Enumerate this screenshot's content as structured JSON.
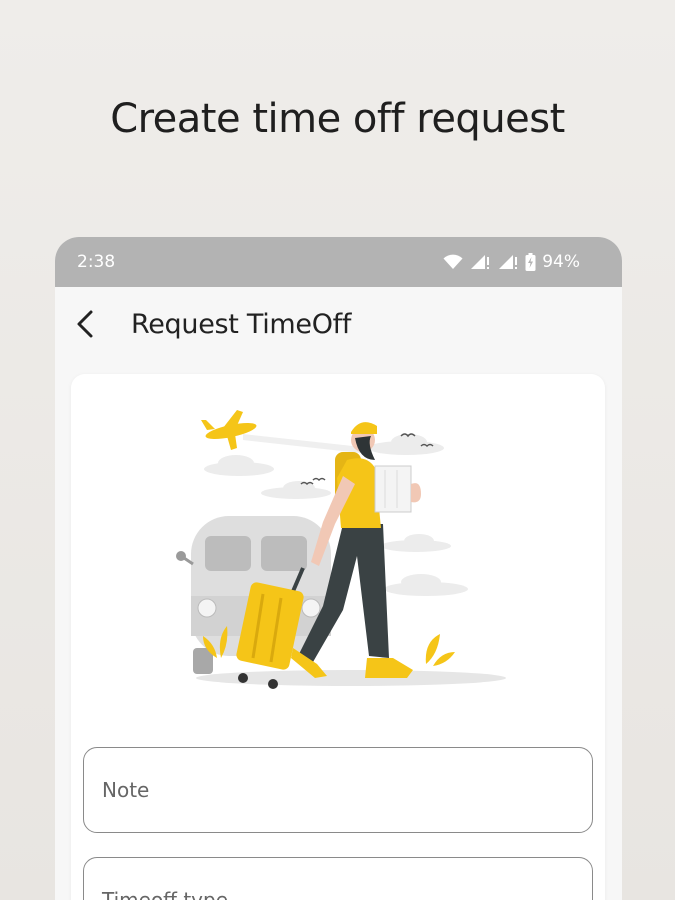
{
  "headline": "Create time off request",
  "status_bar": {
    "time": "2:38",
    "battery": "94%",
    "icons": [
      "wifi-icon",
      "signal-icon",
      "signal-icon",
      "battery-icon"
    ]
  },
  "app_bar": {
    "back_icon": "chevron-left-icon",
    "title": "Request TimeOff"
  },
  "form": {
    "illustration": "traveler-with-suitcase-illustration",
    "note_placeholder": "Note",
    "timeoff_type_placeholder": "Timeoff type"
  },
  "colors": {
    "accent": "#f5c518",
    "status_bar": "#b3b3b3",
    "background": "#ecebe8"
  }
}
